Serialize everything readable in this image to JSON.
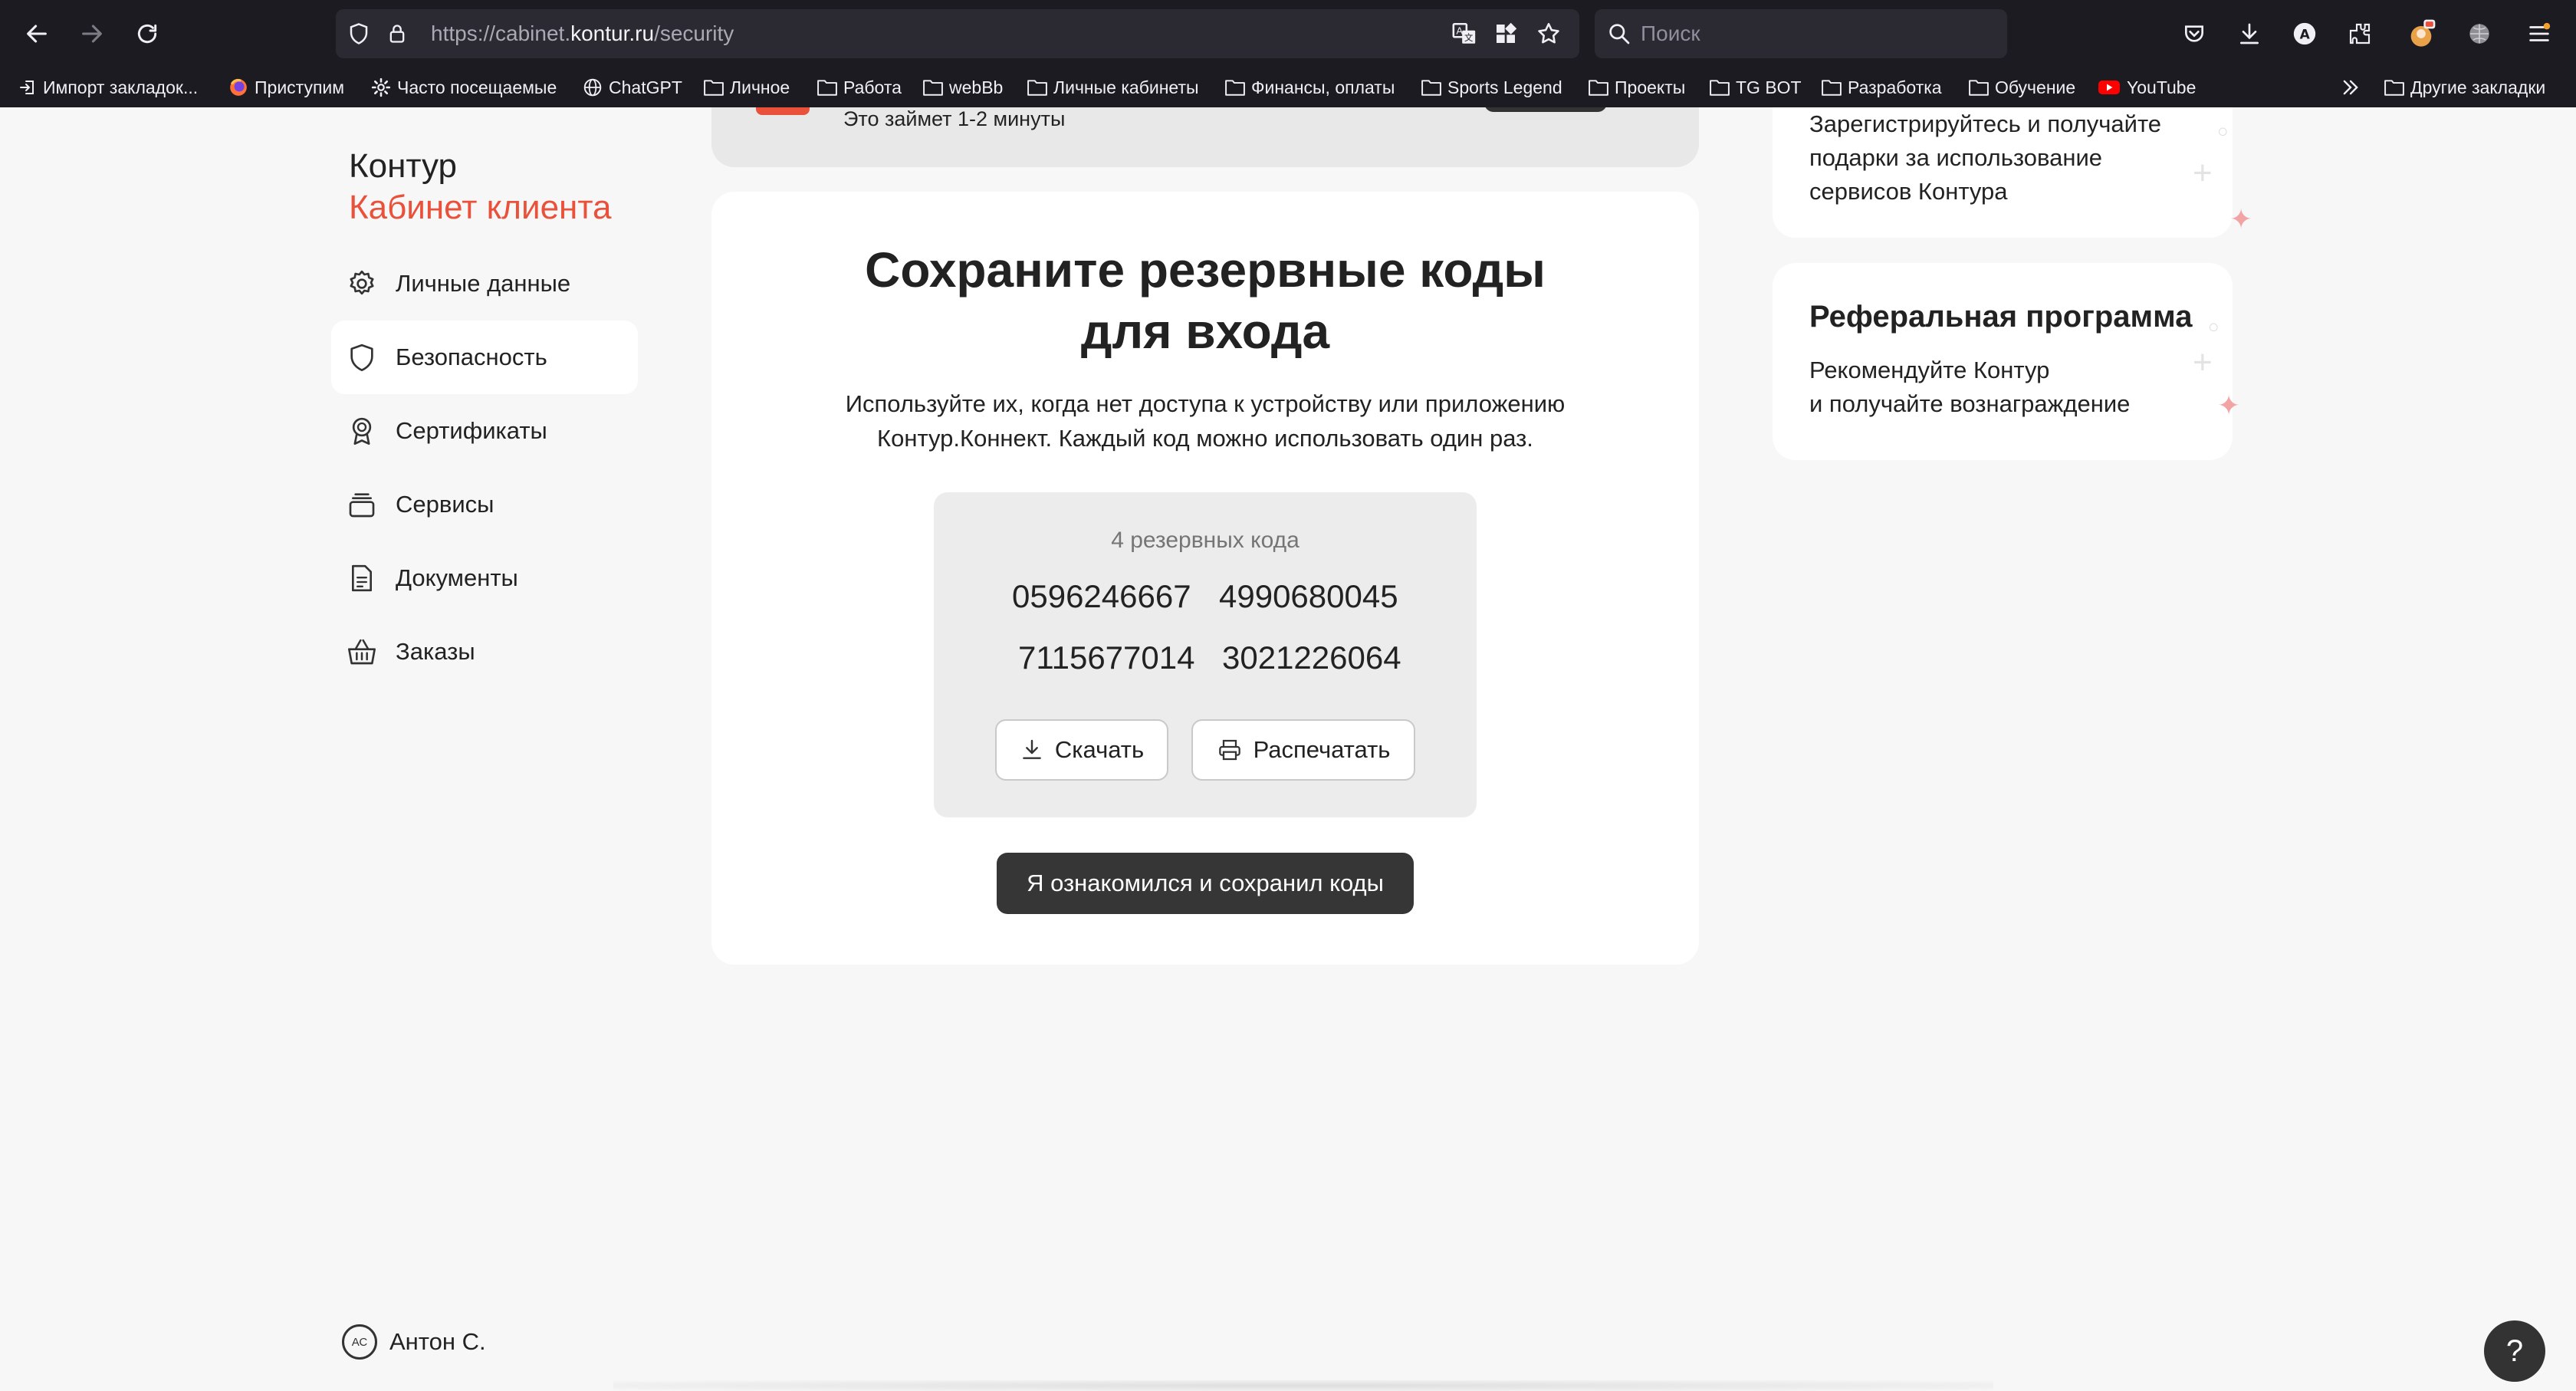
{
  "browser": {
    "url_prefix": "https://cabinet.",
    "url_domain": "kontur.ru",
    "url_path": "/security",
    "search_placeholder": "Поиск"
  },
  "bookmarks": [
    {
      "label": "Импорт закладок...",
      "icon": "import-icon"
    },
    {
      "label": "Приступим",
      "icon": "firefox-icon"
    },
    {
      "label": "Часто посещаемые",
      "icon": "gear-icon"
    },
    {
      "label": "ChatGPT",
      "icon": "globe-icon"
    },
    {
      "label": "Личное",
      "icon": "folder-icon"
    },
    {
      "label": "Работа",
      "icon": "folder-icon"
    },
    {
      "label": "webBb",
      "icon": "folder-icon"
    },
    {
      "label": "Личные кабинеты",
      "icon": "folder-icon"
    },
    {
      "label": "Финансы, оплаты",
      "icon": "folder-icon"
    },
    {
      "label": "Sports Legend",
      "icon": "folder-icon"
    },
    {
      "label": "Проекты",
      "icon": "folder-icon"
    },
    {
      "label": "TG BOT",
      "icon": "folder-icon"
    },
    {
      "label": "Разработка",
      "icon": "folder-icon"
    },
    {
      "label": "Обучение",
      "icon": "folder-icon"
    },
    {
      "label": "YouTube",
      "icon": "youtube-icon"
    }
  ],
  "other_bookmarks": "Другие закладки",
  "sidebar": {
    "brand": "Контур",
    "brand_sub": "Кабинет клиента",
    "items": [
      {
        "label": "Личные данные",
        "icon": "gear-icon"
      },
      {
        "label": "Безопасность",
        "icon": "shield-icon"
      },
      {
        "label": "Сертификаты",
        "icon": "medal-icon"
      },
      {
        "label": "Сервисы",
        "icon": "layers-icon"
      },
      {
        "label": "Документы",
        "icon": "document-icon"
      },
      {
        "label": "Заказы",
        "icon": "basket-icon"
      }
    ],
    "active_index": 1,
    "user_initials": "АС",
    "user_name": "Антон С."
  },
  "top_card": {
    "hint": "Это займет 1-2 минуты"
  },
  "main": {
    "title_line1": "Сохраните резервные коды",
    "title_line2": "для входа",
    "desc_line1": "Используйте их, когда нет доступа к устройству или приложению",
    "desc_line2": "Контур.Коннект. Каждый код можно использовать один раз.",
    "codes_caption": "4 резервных кода",
    "codes": [
      "0596246667",
      "4990680045",
      "7115677014",
      "3021226064"
    ],
    "download_label": "Скачать",
    "print_label": "Распечатать",
    "confirm_label": "Я ознакомился и сохранил коды"
  },
  "right": {
    "card1_line1": "Зарегистрируйтесь и получайте",
    "card1_line2": "подарки за использование",
    "card1_line3": "сервисов Контура",
    "card2_title": "Реферальная программа",
    "card2_line1": "Рекомендуйте Контур",
    "card2_line2": "и получайте вознаграждение"
  },
  "help_label": "?",
  "colors": {
    "accent": "#e9513a",
    "dark_button": "#363636",
    "chrome_bg": "#1c1b22"
  }
}
